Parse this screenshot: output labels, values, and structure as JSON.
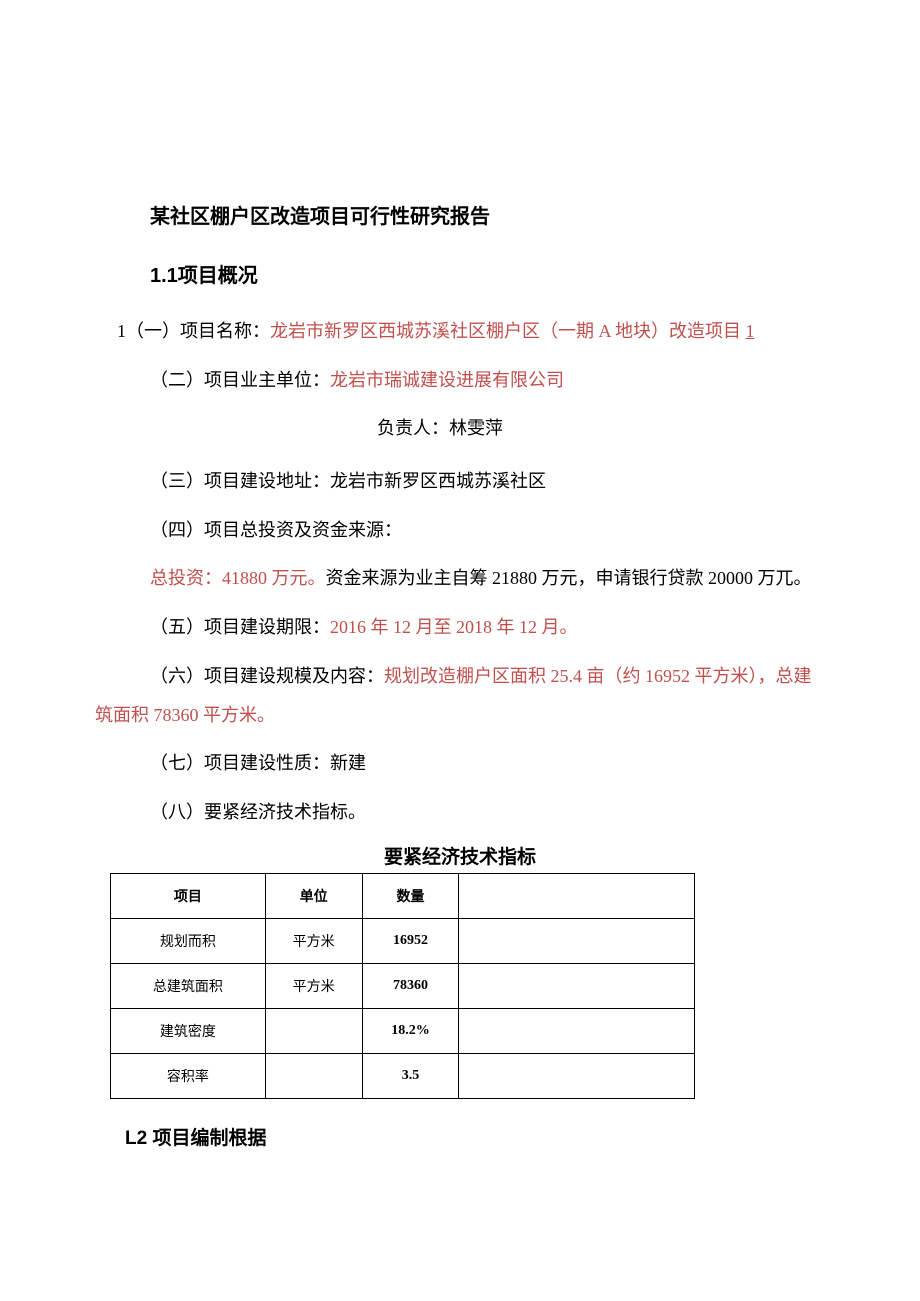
{
  "title": "某社区棚户区改造项目可行性研究报告",
  "section1": {
    "heading": "1.1项目概况",
    "items": {
      "name_label_prefix": "1（一）项目名称：",
      "name_value": "龙岩市新罗区西城苏溪社区棚户区（一期 A 地块）改造项目 ",
      "name_underline": "1",
      "owner_label": "（二）项目业主单位：",
      "owner_value": "龙岩市瑞诚建设进展有限公司",
      "responsible_label": "负责人：",
      "responsible_value": "林雯萍",
      "address_label": "（三）项目建设地址：",
      "address_value": "龙岩市新罗区西城苏溪社区",
      "invest_label": "（四）项目总投资及资金来源：",
      "invest_total_label": "总投资：",
      "invest_total_value": "41880 万元。",
      "invest_rest": "资金来源为业主自筹 21880 万元，申请银行贷款 20000 万兀。",
      "period_label": "（五）项目建设期限：",
      "period_value": "2016 年 12 月至 2018 年 12 月。",
      "scale_label": "（六）项目建设规模及内容：",
      "scale_value_part1": "规划改造棚户区面积 25.4 亩（约 16952 平方米），总建筑面积 78360 平方米。",
      "nature_label": "（七）项目建设性质：",
      "nature_value": "新建",
      "tech_index_label": "（八）要紧经济技术指标。"
    }
  },
  "table": {
    "title": "要紧经济技术指标",
    "headers": [
      "项目",
      "单位",
      "数量",
      ""
    ],
    "rows": [
      {
        "c1": "规划而积",
        "c2": "平方米",
        "c3": "16952",
        "c4": ""
      },
      {
        "c1": "总建筑面积",
        "c2": "平方米",
        "c3": "78360",
        "c4": ""
      },
      {
        "c1": "建筑密度",
        "c2": "",
        "c3": "18.2%",
        "c4": ""
      },
      {
        "c1": "容积率",
        "c2": "",
        "c3": "3.5",
        "c4": ""
      }
    ]
  },
  "section2": {
    "heading": "L2 项目编制根据"
  }
}
